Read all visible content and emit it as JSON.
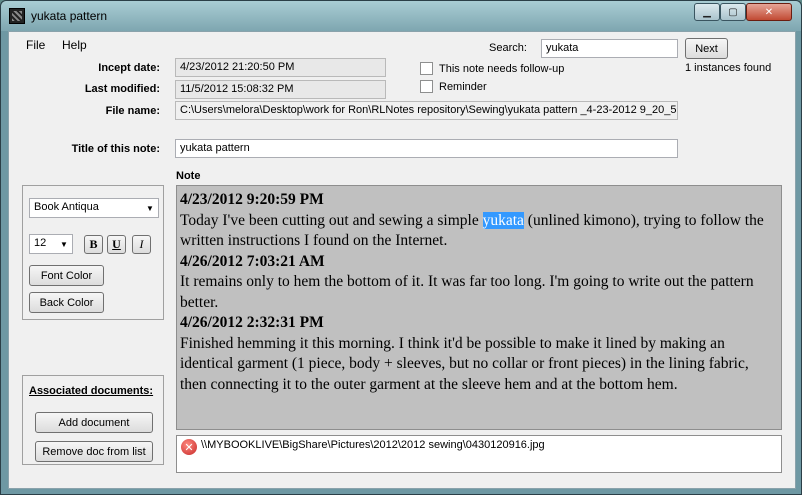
{
  "window": {
    "title": "yukata pattern"
  },
  "menu": [
    "File",
    "Help"
  ],
  "search": {
    "label": "Search:",
    "value": "yukata",
    "next_label": "Next",
    "result": "1 instances found"
  },
  "fields": {
    "incept_label": "Incept date:",
    "incept_value": "4/23/2012 21:20:50 PM",
    "modified_label": "Last modified:",
    "modified_value": "11/5/2012 15:08:32 PM",
    "filename_label": "File name:",
    "filename_value": "C:\\Users\\melora\\Desktop\\work for Ron\\RLNotes repository\\Sewing\\yukata pattern _4-23-2012 9_20_5(",
    "title_label": "Title of this note:",
    "title_value": "yukata pattern"
  },
  "checkboxes": {
    "followup": "This note needs follow-up",
    "reminder": "Reminder"
  },
  "format": {
    "font": "Book Antiqua",
    "size": "12",
    "bold": "B",
    "underline": "U",
    "italic": "I",
    "font_color": "Font Color",
    "back_color": "Back Color"
  },
  "docs": {
    "header": "Associated documents:",
    "add": "Add document",
    "remove": "Remove doc from list",
    "item": "\\\\MYBOOKLIVE\\BigShare\\Pictures\\2012\\2012 sewing\\0430120916.jpg"
  },
  "note": {
    "label": "Note",
    "highlight_color": "#3399ff",
    "entries": [
      {
        "ts": "4/23/2012 9:20:59 PM",
        "pre": "Today I've been cutting out and sewing a simple ",
        "hl": "yukata",
        "post": " (unlined kimono), trying to follow the written instructions I found on the Internet."
      },
      {
        "ts": "4/26/2012 7:03:21 AM",
        "text": "It remains only to hem the bottom of it. It was far too long. I'm going to write out the pattern better."
      },
      {
        "ts": "4/26/2012 2:32:31 PM",
        "text": "Finished hemming it this morning. I think it'd be possible to make it lined by making an identical garment (1 piece, body + sleeves, but no collar or front pieces) in the lining fabric, then connecting it to the outer garment at the sleeve hem and at the bottom hem."
      }
    ]
  }
}
